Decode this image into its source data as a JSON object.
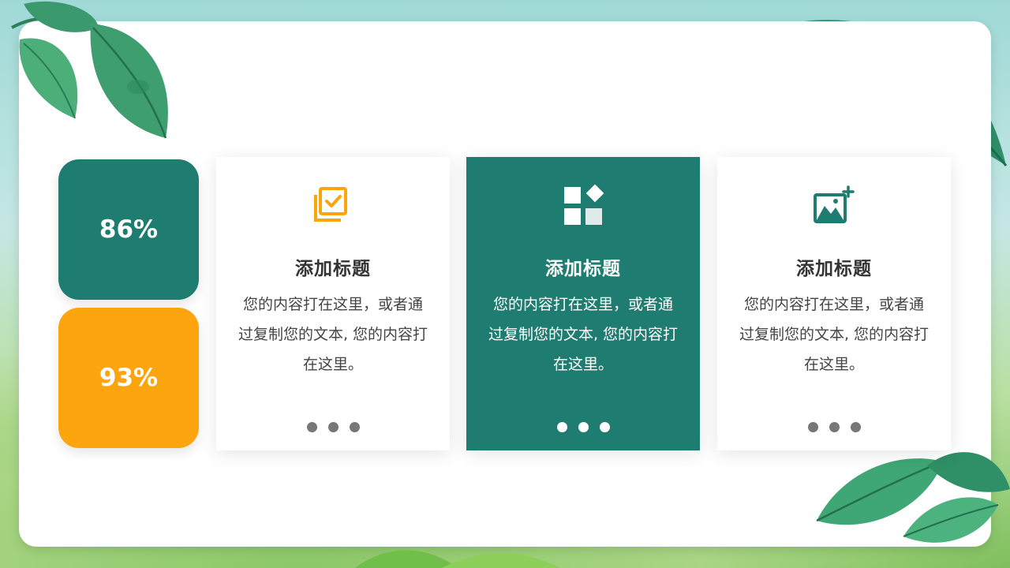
{
  "stats": [
    {
      "value": "86%",
      "color": "#1f7c71"
    },
    {
      "value": "93%",
      "color": "#fda50f"
    }
  ],
  "cards": [
    {
      "icon": "checklist-icon",
      "title": "添加标题",
      "body": "您的内容打在这里，或者通过复制您的文本, 您的内容打在这里。",
      "icon_color": "#fda50f"
    },
    {
      "icon": "grid-shapes-icon",
      "title": "添加标题",
      "body": "您的内容打在这里，或者通过复制您的文本, 您的内容打在这里。",
      "icon_color": "#ffffff"
    },
    {
      "icon": "add-image-icon",
      "title": "添加标题",
      "body": "您的内容打在这里，或者通过复制您的文本, 您的内容打在这里。",
      "icon_color": "#1f7c71"
    }
  ],
  "colors": {
    "accent_green": "#1f7c71",
    "accent_orange": "#fda50f",
    "panel": "#ffffff"
  }
}
